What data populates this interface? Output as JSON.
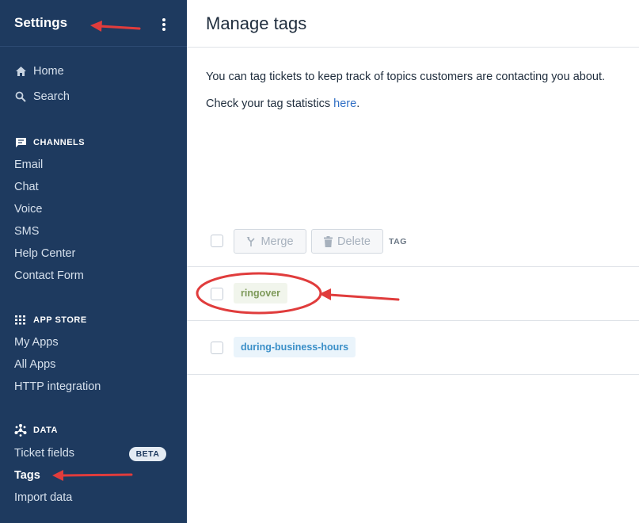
{
  "sidebar": {
    "title": "Settings",
    "nav": [
      {
        "label": "Home",
        "icon": "home-icon"
      },
      {
        "label": "Search",
        "icon": "search-icon"
      }
    ],
    "sections": {
      "channels": {
        "label": "CHANNELS",
        "items": [
          "Email",
          "Chat",
          "Voice",
          "SMS",
          "Help Center",
          "Contact Form"
        ]
      },
      "app_store": {
        "label": "APP STORE",
        "items": [
          "My Apps",
          "All Apps",
          "HTTP integration"
        ]
      },
      "data": {
        "label": "DATA",
        "items": [
          "Ticket fields",
          "Tags",
          "Import data"
        ],
        "beta_badge": "BETA",
        "active": "Tags"
      }
    }
  },
  "main": {
    "title": "Manage tags",
    "intro": "You can tag tickets to keep track of topics customers are contacting you about.",
    "stats_prefix": "Check your tag statistics ",
    "stats_link": "here",
    "stats_suffix": ".",
    "toolbar": {
      "merge_label": "Merge",
      "delete_label": "Delete",
      "column_header": "TAG"
    },
    "tags": [
      {
        "name": "ringover",
        "color": "#7e9a5a"
      },
      {
        "name": "during-business-hours",
        "color": "#3a8fc8"
      }
    ]
  },
  "colors": {
    "sidebar_bg": "#1e3a5f",
    "link": "#2f6ec4",
    "annotation_red": "#e03c3c"
  }
}
